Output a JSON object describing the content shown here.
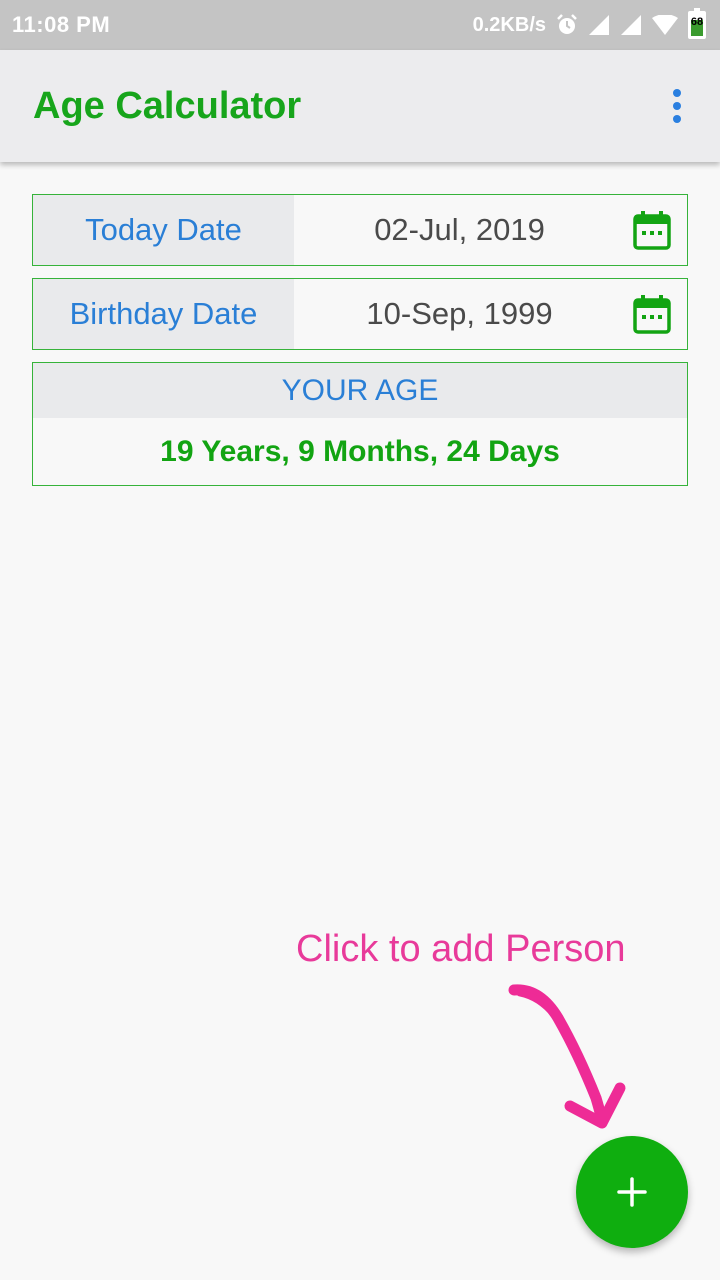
{
  "status_bar": {
    "time": "11:08 PM",
    "network_speed": "0.2KB/s",
    "battery_level": "68",
    "icons": [
      "alarm-icon",
      "signal-icon",
      "signal-icon",
      "wifi-icon",
      "battery-icon"
    ]
  },
  "app_bar": {
    "title": "Age Calculator",
    "menu_icon": "more-vert-icon"
  },
  "today": {
    "label": "Today Date",
    "value": "02-Jul, 2019",
    "icon": "calendar-icon"
  },
  "birthday": {
    "label": "Birthday Date",
    "value": "10-Sep, 1999",
    "icon": "calendar-icon"
  },
  "age": {
    "header": "YOUR AGE",
    "value": "19 Years, 9 Months, 24 Days"
  },
  "hint": {
    "text": "Click to add Person",
    "icon": "hand-drawn-arrow-icon"
  },
  "fab": {
    "icon": "plus-icon"
  },
  "colors": {
    "brand_green": "#17a51b",
    "accent_blue": "#2a7fd6",
    "hint_pink": "#e83a9a",
    "fab_green": "#0fae0f"
  }
}
